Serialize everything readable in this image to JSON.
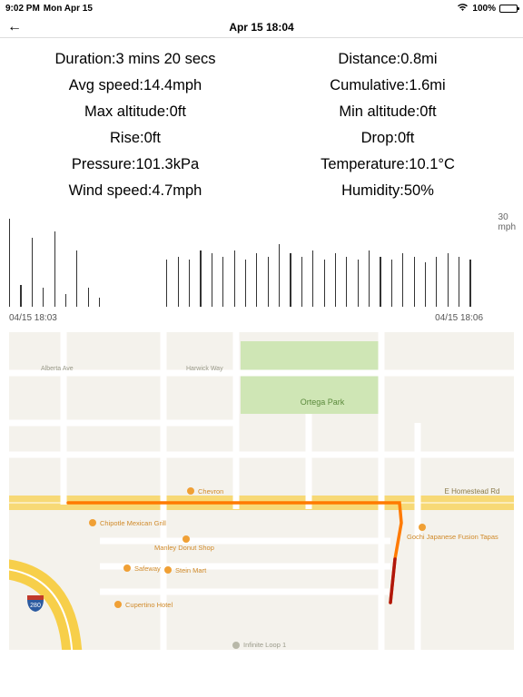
{
  "status_bar": {
    "time": "9:02 PM",
    "date": "Mon Apr 15",
    "battery_pct": "100%",
    "wifi_icon": "wifi",
    "battery_icon": "battery-full"
  },
  "title_bar": {
    "back_icon": "←",
    "title": "Apr 15 18:04"
  },
  "stats": [
    {
      "left_label": "Duration:",
      "left_value": "3 mins 20 secs",
      "right_label": "Distance:",
      "right_value": "0.8mi"
    },
    {
      "left_label": "Avg speed:",
      "left_value": "14.4mph",
      "right_label": "Cumulative:",
      "right_value": "1.6mi"
    },
    {
      "left_label": "Max altitude:",
      "left_value": "0ft",
      "right_label": "Min altitude:",
      "right_value": "0ft"
    },
    {
      "left_label": "Rise:",
      "left_value": "0ft",
      "right_label": "Drop:",
      "right_value": "0ft"
    },
    {
      "left_label": "Pressure:",
      "left_value": "101.3kPa",
      "right_label": "Temperature:",
      "right_value": "10.1°C"
    },
    {
      "left_label": "Wind speed:",
      "left_value": "4.7mph",
      "right_label": "Humidity:",
      "right_value": "50%"
    }
  ],
  "chart_data": {
    "type": "bar",
    "title": "",
    "xlabel": "",
    "ylabel_top": "30",
    "ylabel_unit": "mph",
    "ylim": [
      0,
      30
    ],
    "x_start": "04/15 18:03",
    "x_end": "04/15 18:06",
    "values": [
      28,
      7,
      22,
      6,
      24,
      4,
      18,
      6,
      3,
      null,
      null,
      null,
      null,
      null,
      15,
      16,
      15,
      18,
      17,
      16,
      18,
      15,
      17,
      16,
      20,
      17,
      16,
      18,
      15,
      17,
      16,
      15,
      18,
      16,
      15,
      17,
      16,
      14,
      16,
      17,
      16,
      15
    ]
  },
  "map": {
    "park_name": "Ortega Park",
    "roads": {
      "homestead": "E Homestead Rd",
      "alberta": "Alberta Ave",
      "harwick": "Harwick Way"
    },
    "pois": [
      "Chevron",
      "Chipotle Mexican Grill",
      "Manley Donut Shop",
      "Safeway",
      "Stein Mart",
      "Cupertino Hotel",
      "Gochi Japanese Fusion Tapas",
      "Infinite Loop 1"
    ],
    "interstate": "280"
  }
}
